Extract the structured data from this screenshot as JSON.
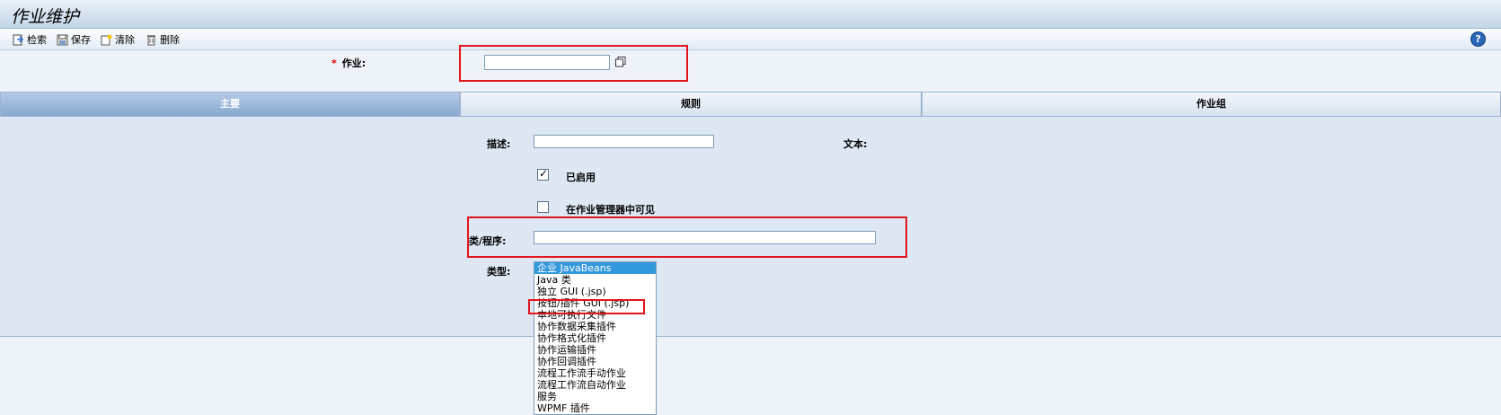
{
  "header": {
    "title": "作业维护"
  },
  "toolbar": {
    "retrieve": "检索",
    "save": "保存",
    "clear": "清除",
    "delete": "删除",
    "help": "?"
  },
  "job": {
    "required_mark": "*",
    "label": "作业:",
    "value": ""
  },
  "tabs": [
    {
      "label": "主要",
      "active": true
    },
    {
      "label": "规则",
      "active": false
    },
    {
      "label": "作业组",
      "active": false
    }
  ],
  "form": {
    "description_label": "描述:",
    "description_value": "",
    "text_label": "文本:",
    "enabled_label": "已启用",
    "enabled_checked": true,
    "visible_label": "在作业管理器中可见",
    "visible_checked": false,
    "class_label": "类/程序:",
    "class_value": "",
    "type_label": "类型:",
    "type_options": [
      "企业 JavaBeans",
      "Java 类",
      "独立 GUI (.jsp)",
      "按钮/插件 GUI (.jsp)",
      "本地可执行文件",
      "协作数据采集插件",
      "协作格式化插件",
      "协作运输插件",
      "协作回调插件",
      "流程工作流手动作业",
      "流程工作流自动作业",
      "服务",
      "WPMF 插件"
    ],
    "type_selected_index": 0
  },
  "colors": {
    "highlight": "#e3141c",
    "selection": "#3399dd"
  }
}
